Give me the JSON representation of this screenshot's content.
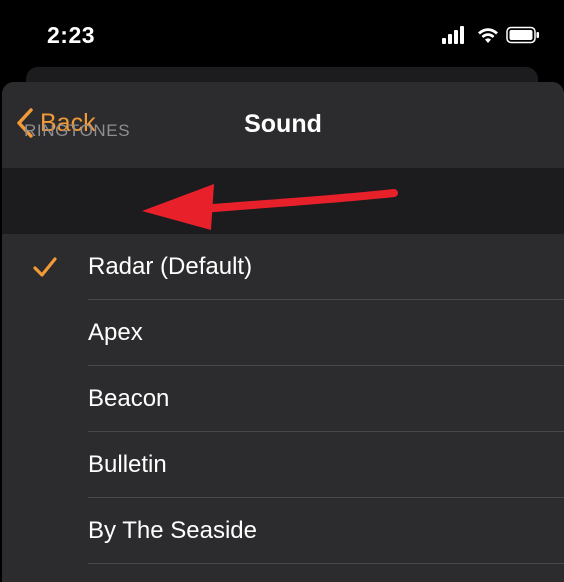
{
  "status_bar": {
    "time": "2:23",
    "icons": [
      "cellular-signal-icon",
      "wifi-icon",
      "battery-icon"
    ]
  },
  "nav": {
    "back_label": "Back",
    "title": "Sound"
  },
  "section": {
    "title": "RINGTONES"
  },
  "ringtones": [
    {
      "label": "Radar (Default)",
      "selected": true
    },
    {
      "label": "Apex",
      "selected": false
    },
    {
      "label": "Beacon",
      "selected": false
    },
    {
      "label": "Bulletin",
      "selected": false
    },
    {
      "label": "By The Seaside",
      "selected": false
    }
  ],
  "colors": {
    "accent": "#f19a37",
    "annotation": "#e8202a",
    "background": "#2c2c2e",
    "section_background": "#1c1c1e"
  }
}
